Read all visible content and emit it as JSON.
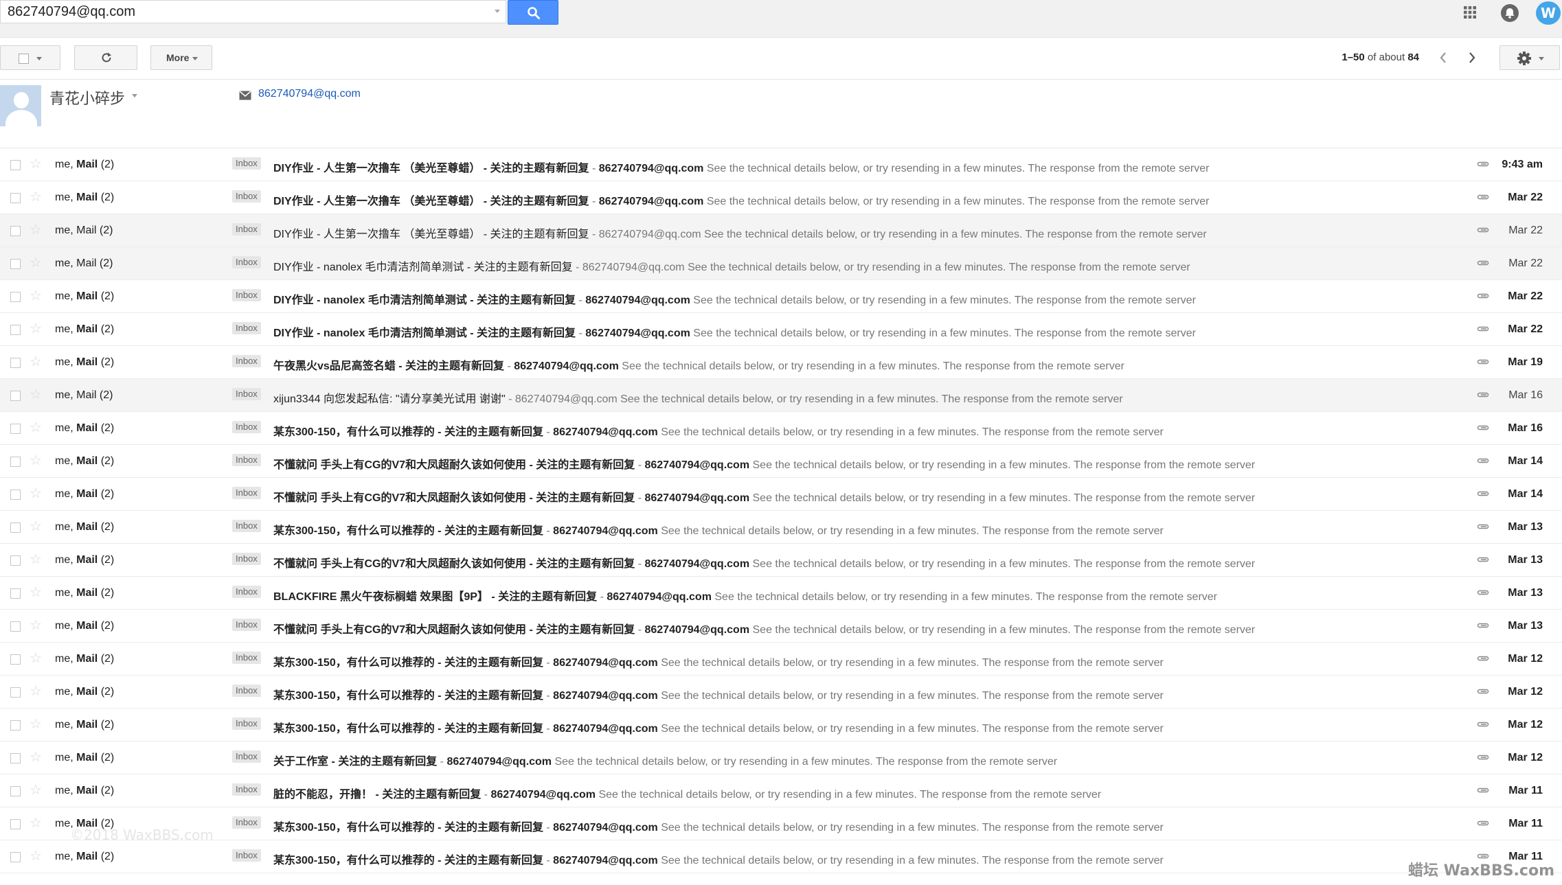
{
  "search": {
    "value": "862740794@qq.com"
  },
  "toolbar": {
    "more_label": "More"
  },
  "pagination": {
    "range": "1–50",
    "of_about": "of about",
    "total": "84"
  },
  "account": {
    "initial": "W"
  },
  "contact": {
    "name": "青花小碎步",
    "email": "862740794@qq.com"
  },
  "message_template": {
    "sender_me": "me,",
    "sender_mail": "Mail",
    "count": "(2)",
    "label": "Inbox",
    "separator": " - ",
    "email": "862740794@qq.com",
    "snippet": "See the technical details below, or try resending in a few minutes. The response from the remote server"
  },
  "messages": [
    {
      "subject": "DIY作业 - 人生第一次撸车 （美光至尊蜡） - 关注的主题有新回复",
      "date": "9:43 am",
      "read": false
    },
    {
      "subject": "DIY作业 - 人生第一次撸车 （美光至尊蜡） - 关注的主题有新回复",
      "date": "Mar 22",
      "read": false
    },
    {
      "subject": "DIY作业 - 人生第一次撸车 （美光至尊蜡） - 关注的主题有新回复",
      "date": "Mar 22",
      "read": true
    },
    {
      "subject": "DIY作业 - nanolex 毛巾清洁剂简单测试 - 关注的主题有新回复",
      "date": "Mar 22",
      "read": true
    },
    {
      "subject": "DIY作业 - nanolex 毛巾清洁剂简单测试 - 关注的主题有新回复",
      "date": "Mar 22",
      "read": false
    },
    {
      "subject": "DIY作业 - nanolex 毛巾清洁剂简单测试 - 关注的主题有新回复",
      "date": "Mar 22",
      "read": false
    },
    {
      "subject": "午夜黑火vs品尼高签名蜡 - 关注的主题有新回复",
      "date": "Mar 19",
      "read": false
    },
    {
      "subject": "xijun3344 向您发起私信: \"请分享美光试用 谢谢\"",
      "date": "Mar 16",
      "read": true
    },
    {
      "subject": "某东300-150，有什么可以推荐的 - 关注的主题有新回复",
      "date": "Mar 16",
      "read": false
    },
    {
      "subject": "不懂就问 手头上有CG的V7和大凤超耐久该如何使用 - 关注的主题有新回复",
      "date": "Mar 14",
      "read": false
    },
    {
      "subject": "不懂就问 手头上有CG的V7和大凤超耐久该如何使用 - 关注的主题有新回复",
      "date": "Mar 14",
      "read": false
    },
    {
      "subject": "某东300-150，有什么可以推荐的 - 关注的主题有新回复",
      "date": "Mar 13",
      "read": false
    },
    {
      "subject": "不懂就问 手头上有CG的V7和大凤超耐久该如何使用 - 关注的主题有新回复",
      "date": "Mar 13",
      "read": false
    },
    {
      "subject": "BLACKFIRE 黑火午夜标榈蜡 效果图【9P】 - 关注的主题有新回复",
      "date": "Mar 13",
      "read": false
    },
    {
      "subject": "不懂就问 手头上有CG的V7和大凤超耐久该如何使用 - 关注的主题有新回复",
      "date": "Mar 13",
      "read": false
    },
    {
      "subject": "某东300-150，有什么可以推荐的 - 关注的主题有新回复",
      "date": "Mar 12",
      "read": false
    },
    {
      "subject": "某东300-150，有什么可以推荐的 - 关注的主题有新回复",
      "date": "Mar 12",
      "read": false
    },
    {
      "subject": "某东300-150，有什么可以推荐的 - 关注的主题有新回复",
      "date": "Mar 12",
      "read": false
    },
    {
      "subject": "关于工作室 - 关注的主题有新回复",
      "date": "Mar 12",
      "read": false
    },
    {
      "subject": "脏的不能忍，开撸！ - 关注的主题有新回复",
      "date": "Mar 11",
      "read": false
    },
    {
      "subject": "某东300-150，有什么可以推荐的 - 关注的主题有新回复",
      "date": "Mar 11",
      "read": false
    },
    {
      "subject": "某东300-150，有什么可以推荐的 - 关注的主题有新回复",
      "date": "Mar 11",
      "read": false
    }
  ],
  "watermarks": {
    "left": "©2018 WaxBBS.com",
    "right": "蜡坛 WaxBBS.com"
  },
  "colors": {
    "search_button": "#4d90fe",
    "link": "#1a5ab8",
    "account": "#44a5e8"
  }
}
